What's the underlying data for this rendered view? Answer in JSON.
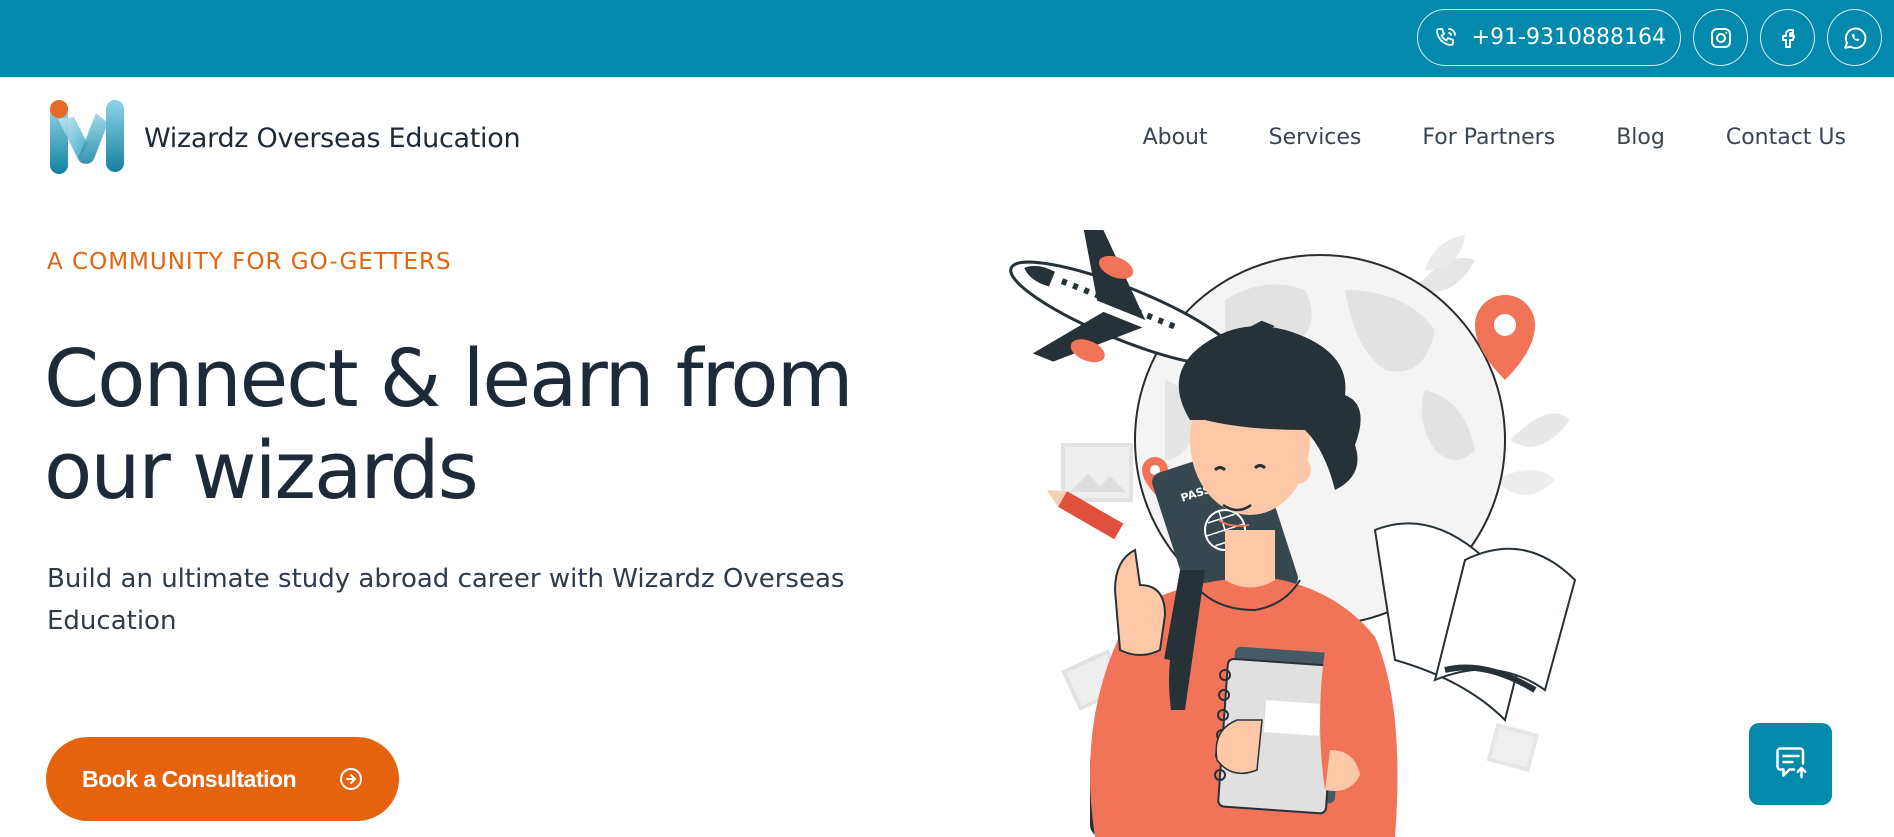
{
  "topbar": {
    "phone": "+91-9310888164",
    "icons": [
      "phone-icon",
      "instagram-icon",
      "facebook-icon",
      "whatsapp-icon"
    ],
    "background": "#0289ab"
  },
  "header": {
    "brand": "Wizardz Overseas Education",
    "nav": [
      {
        "label": "About"
      },
      {
        "label": "Services"
      },
      {
        "label": "For Partners"
      },
      {
        "label": "Blog"
      },
      {
        "label": "Contact Us"
      }
    ]
  },
  "hero": {
    "eyebrow": "A COMMUNITY FOR GO-GETTERS",
    "title": "Connect & learn from our wizards",
    "subtitle": "Build an ultimate study abroad career with Wizardz Overseas Education",
    "cta_label": "Book a Consultation",
    "illustration_text": "PASSPORT"
  },
  "colors": {
    "accent": "#e5630d",
    "primary": "#0289ab",
    "text": "#1e2a38",
    "illustration": "#f27458"
  }
}
